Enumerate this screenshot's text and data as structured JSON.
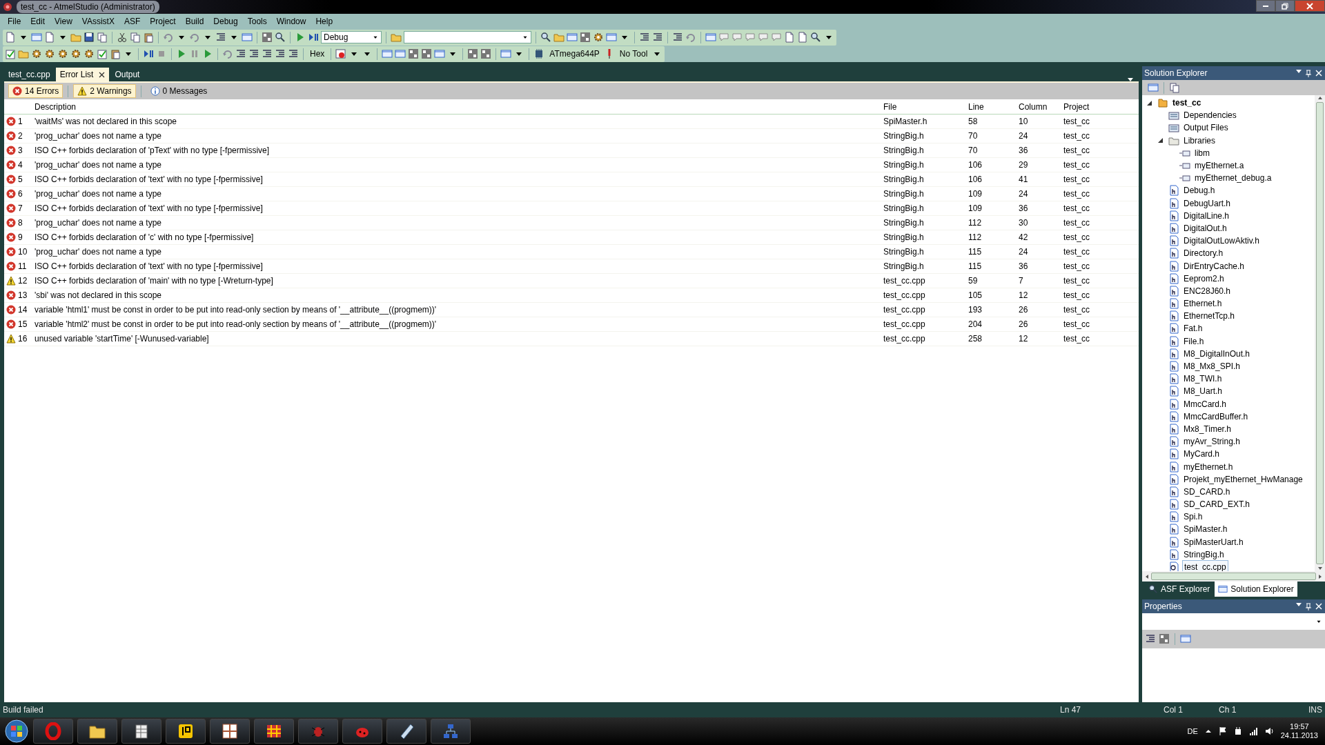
{
  "window": {
    "title": "test_cc - AtmelStudio (Administrator)"
  },
  "menu": [
    "File",
    "Edit",
    "View",
    "VAssistX",
    "ASF",
    "Project",
    "Build",
    "Debug",
    "Tools",
    "Window",
    "Help"
  ],
  "toolbar": {
    "configuration": "Debug",
    "hex": "Hex",
    "device": "ATmega644P",
    "tool": "No Tool"
  },
  "document_tabs": [
    {
      "label": "test_cc.cpp",
      "selected": false
    },
    {
      "label": "Error List",
      "selected": true
    },
    {
      "label": "Output",
      "selected": false
    }
  ],
  "error_list": {
    "filters": [
      {
        "kind": "error",
        "label": "14 Errors",
        "on": true
      },
      {
        "kind": "warning",
        "label": "2 Warnings",
        "on": true
      },
      {
        "kind": "info",
        "label": "0 Messages",
        "on": false
      }
    ],
    "columns": [
      "Description",
      "File",
      "Line",
      "Column",
      "Project"
    ],
    "rows": [
      {
        "kind": "error",
        "number": "1",
        "description": "'waitMs' was not declared in this scope",
        "file": "SpiMaster.h",
        "line": "58",
        "column": "10",
        "project": "test_cc"
      },
      {
        "kind": "error",
        "number": "2",
        "description": "'prog_uchar' does not name a type",
        "file": "StringBig.h",
        "line": "70",
        "column": "24",
        "project": "test_cc"
      },
      {
        "kind": "error",
        "number": "3",
        "description": "ISO C++ forbids declaration of 'pText' with no type [-fpermissive]",
        "file": "StringBig.h",
        "line": "70",
        "column": "36",
        "project": "test_cc"
      },
      {
        "kind": "error",
        "number": "4",
        "description": "'prog_uchar' does not name a type",
        "file": "StringBig.h",
        "line": "106",
        "column": "29",
        "project": "test_cc"
      },
      {
        "kind": "error",
        "number": "5",
        "description": "ISO C++ forbids declaration of 'text' with no type [-fpermissive]",
        "file": "StringBig.h",
        "line": "106",
        "column": "41",
        "project": "test_cc"
      },
      {
        "kind": "error",
        "number": "6",
        "description": "'prog_uchar' does not name a type",
        "file": "StringBig.h",
        "line": "109",
        "column": "24",
        "project": "test_cc"
      },
      {
        "kind": "error",
        "number": "7",
        "description": "ISO C++ forbids declaration of 'text' with no type [-fpermissive]",
        "file": "StringBig.h",
        "line": "109",
        "column": "36",
        "project": "test_cc"
      },
      {
        "kind": "error",
        "number": "8",
        "description": "'prog_uchar' does not name a type",
        "file": "StringBig.h",
        "line": "112",
        "column": "30",
        "project": "test_cc"
      },
      {
        "kind": "error",
        "number": "9",
        "description": "ISO C++ forbids declaration of 'c' with no type [-fpermissive]",
        "file": "StringBig.h",
        "line": "112",
        "column": "42",
        "project": "test_cc"
      },
      {
        "kind": "error",
        "number": "10",
        "description": "'prog_uchar' does not name a type",
        "file": "StringBig.h",
        "line": "115",
        "column": "24",
        "project": "test_cc"
      },
      {
        "kind": "error",
        "number": "11",
        "description": "ISO C++ forbids declaration of 'text' with no type [-fpermissive]",
        "file": "StringBig.h",
        "line": "115",
        "column": "36",
        "project": "test_cc"
      },
      {
        "kind": "warning",
        "number": "12",
        "description": "ISO C++ forbids declaration of 'main' with no type [-Wreturn-type]",
        "file": "test_cc.cpp",
        "line": "59",
        "column": "7",
        "project": "test_cc"
      },
      {
        "kind": "error",
        "number": "13",
        "description": "'sbi' was not declared in this scope",
        "file": "test_cc.cpp",
        "line": "105",
        "column": "12",
        "project": "test_cc"
      },
      {
        "kind": "error",
        "number": "14",
        "description": "variable 'html1' must be const in order to be put into read-only section by means of '__attribute__((progmem))'",
        "file": "test_cc.cpp",
        "line": "193",
        "column": "26",
        "project": "test_cc"
      },
      {
        "kind": "error",
        "number": "15",
        "description": "variable 'html2' must be const in order to be put into read-only section by means of '__attribute__((progmem))'",
        "file": "test_cc.cpp",
        "line": "204",
        "column": "26",
        "project": "test_cc"
      },
      {
        "kind": "warning",
        "number": "16",
        "description": "unused variable 'startTime' [-Wunused-variable]",
        "file": "test_cc.cpp",
        "line": "258",
        "column": "12",
        "project": "test_cc"
      }
    ]
  },
  "solution_explorer": {
    "title": "Solution Explorer",
    "tree": [
      {
        "label": "test_cc",
        "kind": "project",
        "expanded": true,
        "selected": false,
        "children": [
          {
            "label": "Dependencies",
            "kind": "virtual-folder",
            "selected": false
          },
          {
            "label": "Output Files",
            "kind": "virtual-folder",
            "selected": false
          },
          {
            "label": "Libraries",
            "kind": "folder",
            "expanded": true,
            "selected": false,
            "children": [
              {
                "label": "libm",
                "kind": "library",
                "selected": false
              },
              {
                "label": "myEthernet.a",
                "kind": "library",
                "selected": false
              },
              {
                "label": "myEthernet_debug.a",
                "kind": "library",
                "selected": false
              }
            ]
          },
          {
            "label": "Debug.h",
            "kind": "header",
            "selected": false
          },
          {
            "label": "DebugUart.h",
            "kind": "header",
            "selected": false
          },
          {
            "label": "DigitalLine.h",
            "kind": "header",
            "selected": false
          },
          {
            "label": "DigitalOut.h",
            "kind": "header",
            "selected": false
          },
          {
            "label": "DigitalOutLowAktiv.h",
            "kind": "header",
            "selected": false
          },
          {
            "label": "Directory.h",
            "kind": "header",
            "selected": false
          },
          {
            "label": "DirEntryCache.h",
            "kind": "header",
            "selected": false
          },
          {
            "label": "Eeprom2.h",
            "kind": "header",
            "selected": false
          },
          {
            "label": "ENC28J60.h",
            "kind": "header",
            "selected": false
          },
          {
            "label": "Ethernet.h",
            "kind": "header",
            "selected": false
          },
          {
            "label": "EthernetTcp.h",
            "kind": "header",
            "selected": false
          },
          {
            "label": "Fat.h",
            "kind": "header",
            "selected": false
          },
          {
            "label": "File.h",
            "kind": "header",
            "selected": false
          },
          {
            "label": "M8_DigitalInOut.h",
            "kind": "header",
            "selected": false
          },
          {
            "label": "M8_Mx8_SPI.h",
            "kind": "header",
            "selected": false
          },
          {
            "label": "M8_TWI.h",
            "kind": "header",
            "selected": false
          },
          {
            "label": "M8_Uart.h",
            "kind": "header",
            "selected": false
          },
          {
            "label": "MmcCard.h",
            "kind": "header",
            "selected": false
          },
          {
            "label": "MmcCardBuffer.h",
            "kind": "header",
            "selected": false
          },
          {
            "label": "Mx8_Timer.h",
            "kind": "header",
            "selected": false
          },
          {
            "label": "myAvr_String.h",
            "kind": "header",
            "selected": false
          },
          {
            "label": "MyCard.h",
            "kind": "header",
            "selected": false
          },
          {
            "label": "myEthernet.h",
            "kind": "header",
            "selected": false
          },
          {
            "label": "Projekt_myEthernet_HwManage",
            "kind": "header",
            "selected": false
          },
          {
            "label": "SD_CARD.h",
            "kind": "header",
            "selected": false
          },
          {
            "label": "SD_CARD_EXT.h",
            "kind": "header",
            "selected": false
          },
          {
            "label": "Spi.h",
            "kind": "header",
            "selected": false
          },
          {
            "label": "SpiMaster.h",
            "kind": "header",
            "selected": false
          },
          {
            "label": "SpiMasterUart.h",
            "kind": "header",
            "selected": false
          },
          {
            "label": "StringBig.h",
            "kind": "header",
            "selected": false
          },
          {
            "label": "test_cc.cpp",
            "kind": "cpp",
            "selected": true
          }
        ]
      }
    ],
    "tabs": [
      {
        "label": "ASF Explorer",
        "selected": false
      },
      {
        "label": "Solution Explorer",
        "selected": true
      }
    ]
  },
  "properties": {
    "title": "Properties"
  },
  "status_bar": {
    "message": "Build failed",
    "line": "Ln 47",
    "column": "Col 1",
    "char": "Ch 1",
    "mode": "INS"
  },
  "taskbar": {
    "language": "DE",
    "time": "19:57",
    "date": "24.11.2013"
  }
}
